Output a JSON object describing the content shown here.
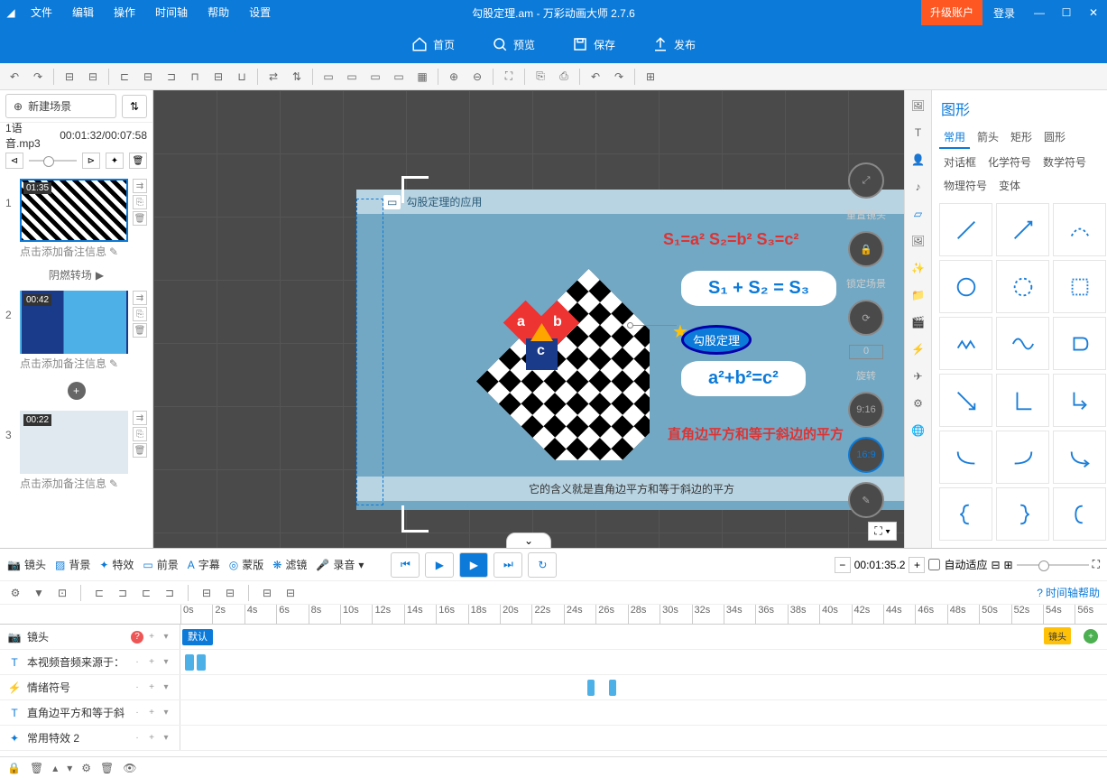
{
  "title": "勾股定理.am - 万彩动画大师 2.7.6",
  "upgrade": "升级账户",
  "login": "登录",
  "menu": [
    "文件",
    "编辑",
    "操作",
    "时间轴",
    "帮助",
    "设置"
  ],
  "tabs": {
    "home": "首页",
    "preview": "预览",
    "save": "保存",
    "publish": "发布"
  },
  "new_scene": "新建场景",
  "audio": {
    "name": "1语音.mp3",
    "time": "00:01:32/00:07:58"
  },
  "scenes": [
    {
      "dur": "01:35",
      "label": "点击添加备注信息",
      "transition": "阴燃转场"
    },
    {
      "dur": "00:42",
      "label": "点击添加备注信息"
    },
    {
      "dur": "00:22",
      "label": "点击添加备注信息"
    }
  ],
  "float": {
    "reset": "重置镜头",
    "lock": "锁定场景",
    "rotate": "旋转",
    "rot_val": "0",
    "ratio1": "9:16",
    "ratio2": "16:9"
  },
  "slide": {
    "title": "勾股定理的应用",
    "formula": "S₁=a²  S₂=b²  S₃=c²",
    "eq1": "S₁ + S₂ = S₃",
    "badge": "勾股定理",
    "eq2": "a²+b²=c²",
    "red": "直角边平方和等于斜边的平方",
    "caption": "它的含义就是直角边平方和等于斜边的平方",
    "a": "a",
    "b": "b",
    "c": "c"
  },
  "shapes": {
    "title": "图形",
    "tabs": [
      "常用",
      "箭头",
      "矩形",
      "圆形",
      "对话框",
      "化学符号",
      "数学符号",
      "物理符号",
      "变体"
    ]
  },
  "bottom": {
    "tools": [
      "镜头",
      "背景",
      "特效",
      "前景",
      "字幕",
      "蒙版",
      "滤镜",
      "录音"
    ],
    "time": "00:01:35.2",
    "autofit": "自动适应",
    "help": "时间轴帮助"
  },
  "ruler": [
    "0s",
    "2s",
    "4s",
    "6s",
    "8s",
    "10s",
    "12s",
    "14s",
    "16s",
    "18s",
    "20s",
    "22s",
    "24s",
    "26s",
    "28s",
    "30s",
    "32s",
    "34s",
    "36s",
    "38s",
    "40s",
    "42s",
    "44s",
    "46s",
    "48s",
    "50s",
    "52s",
    "54s",
    "56s"
  ],
  "tracks": [
    {
      "icon": "📷",
      "name": "镜头",
      "default": "默认",
      "cam": "镜头"
    },
    {
      "icon": "T",
      "name": "本视频音频来源于：",
      "clips": [
        {
          "l": 5,
          "w": 10
        },
        {
          "l": 18,
          "w": 10
        }
      ]
    },
    {
      "icon": "⚡",
      "name": "情绪符号",
      "clips": [
        {
          "l": 451,
          "w": 8
        },
        {
          "l": 475,
          "w": 8
        }
      ]
    },
    {
      "icon": "T",
      "name": "直角边平方和等于斜",
      "clips": []
    },
    {
      "icon": "✦",
      "name": "常用特效 2",
      "clips": []
    }
  ]
}
